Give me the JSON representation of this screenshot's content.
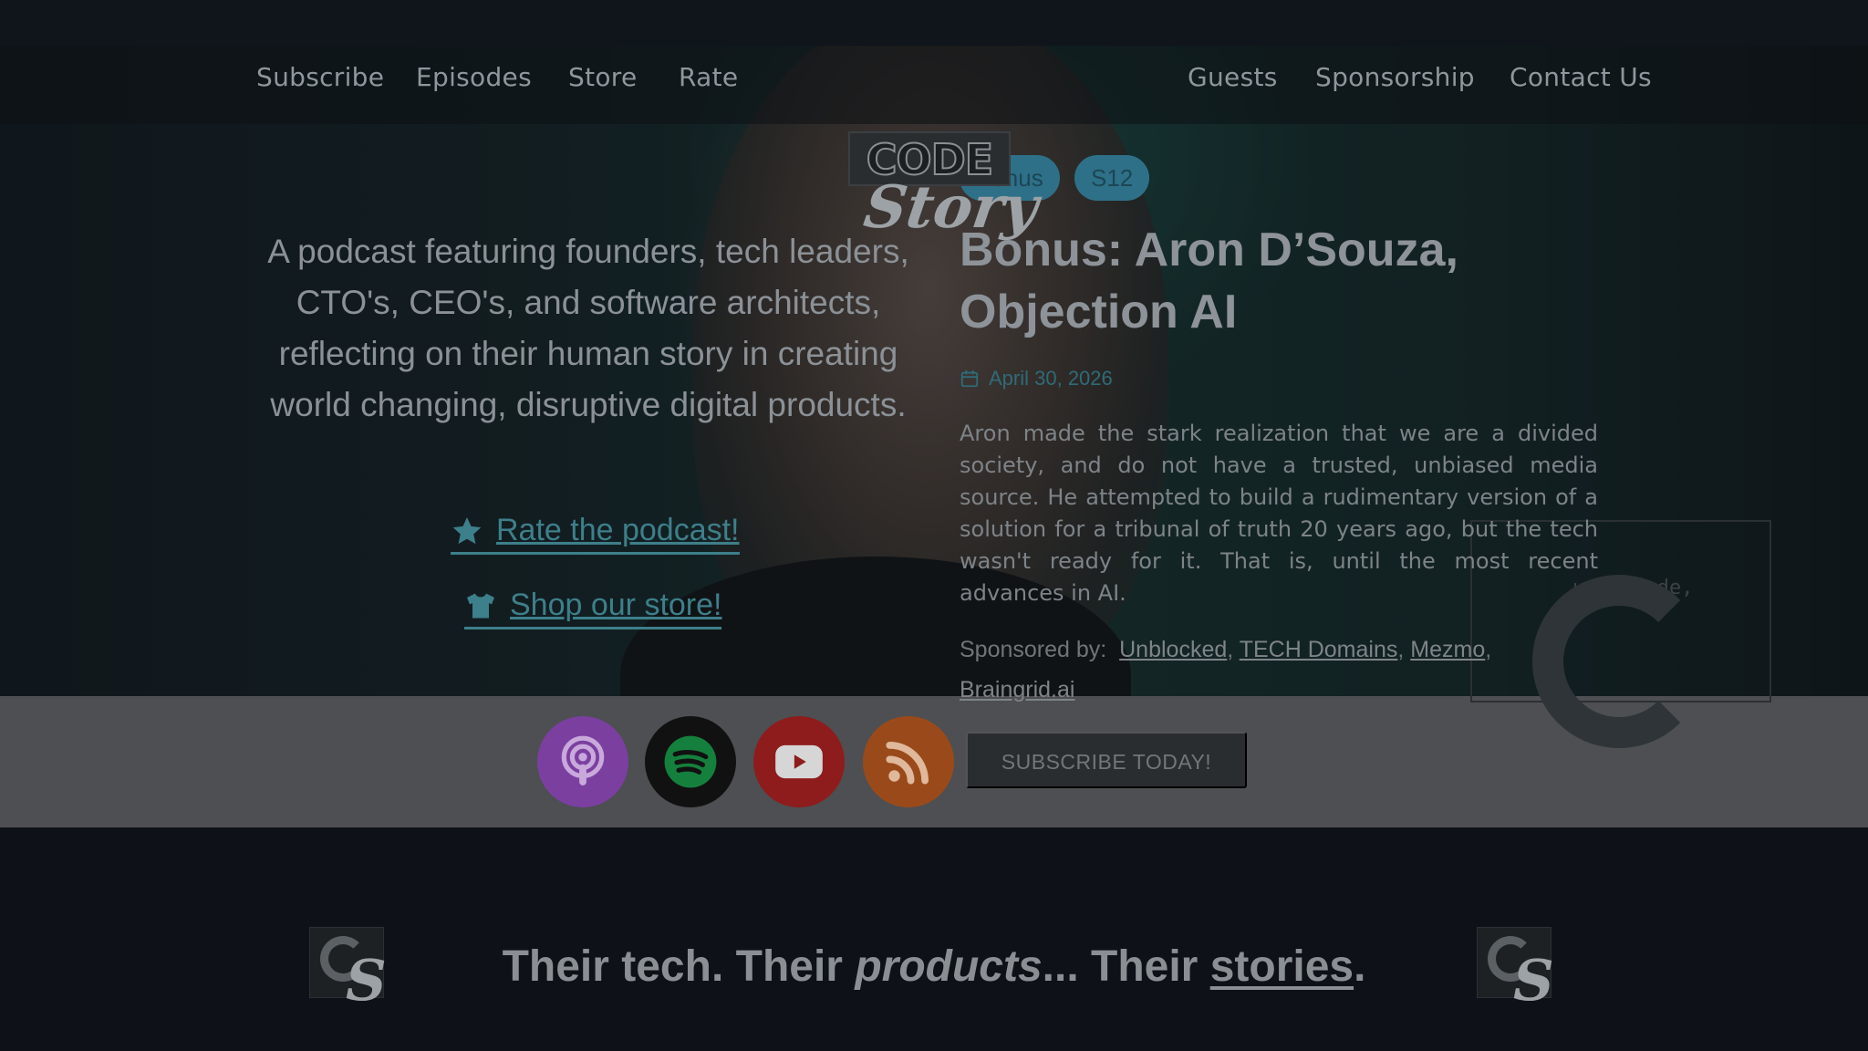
{
  "nav": {
    "left": [
      "Subscribe",
      "Episodes",
      "Store",
      "Rate"
    ],
    "right": [
      "Guests",
      "Sponsorship",
      "Contact Us"
    ]
  },
  "logo": {
    "top": "CODE",
    "bottom": "Story"
  },
  "hero": {
    "tagline": "A podcast featuring founders, tech leaders, CTO's, CEO's, and software architects, reflecting on their human story in creating world changing, disruptive digital products.",
    "rate_link": "Rate the podcast!",
    "store_link": "Shop our store!"
  },
  "episode": {
    "badges": [
      "Bonus",
      "S12"
    ],
    "title": "Bonus: Aron D’Souza, Objection AI",
    "date": "April 30, 2026",
    "description": "Aron made the stark realization that we are a divided society, and do not have a trusted, unbiased media source. He attempted to build a rudimentary version of a solution for a tribunal of truth 20 years ago, but the tech wasn't ready for it. That is, until the most recent advances in AI.",
    "sponsored_label": "Sponsored by:",
    "sponsors": [
      "Unblocked",
      "TECH Domains",
      "Mezmo",
      "Braingrid.ai"
    ],
    "decor_text": "urce node,"
  },
  "subscribe": {
    "platforms": [
      "apple-podcasts",
      "spotify",
      "youtube",
      "rss"
    ],
    "button_label": "SUBSCRIBE TODAY!"
  },
  "footer": {
    "motto_part1": "Their tech. Their ",
    "motto_em": "products",
    "motto_part2": "... Their ",
    "motto_link": "stories",
    "motto_end": "."
  },
  "colors": {
    "accent": "#3d7f8a",
    "badge": "#2e7088",
    "apple": "#7b3fa0",
    "spotify": "#111111",
    "youtube": "#8e1c1c",
    "rss": "#9a4a1a"
  }
}
